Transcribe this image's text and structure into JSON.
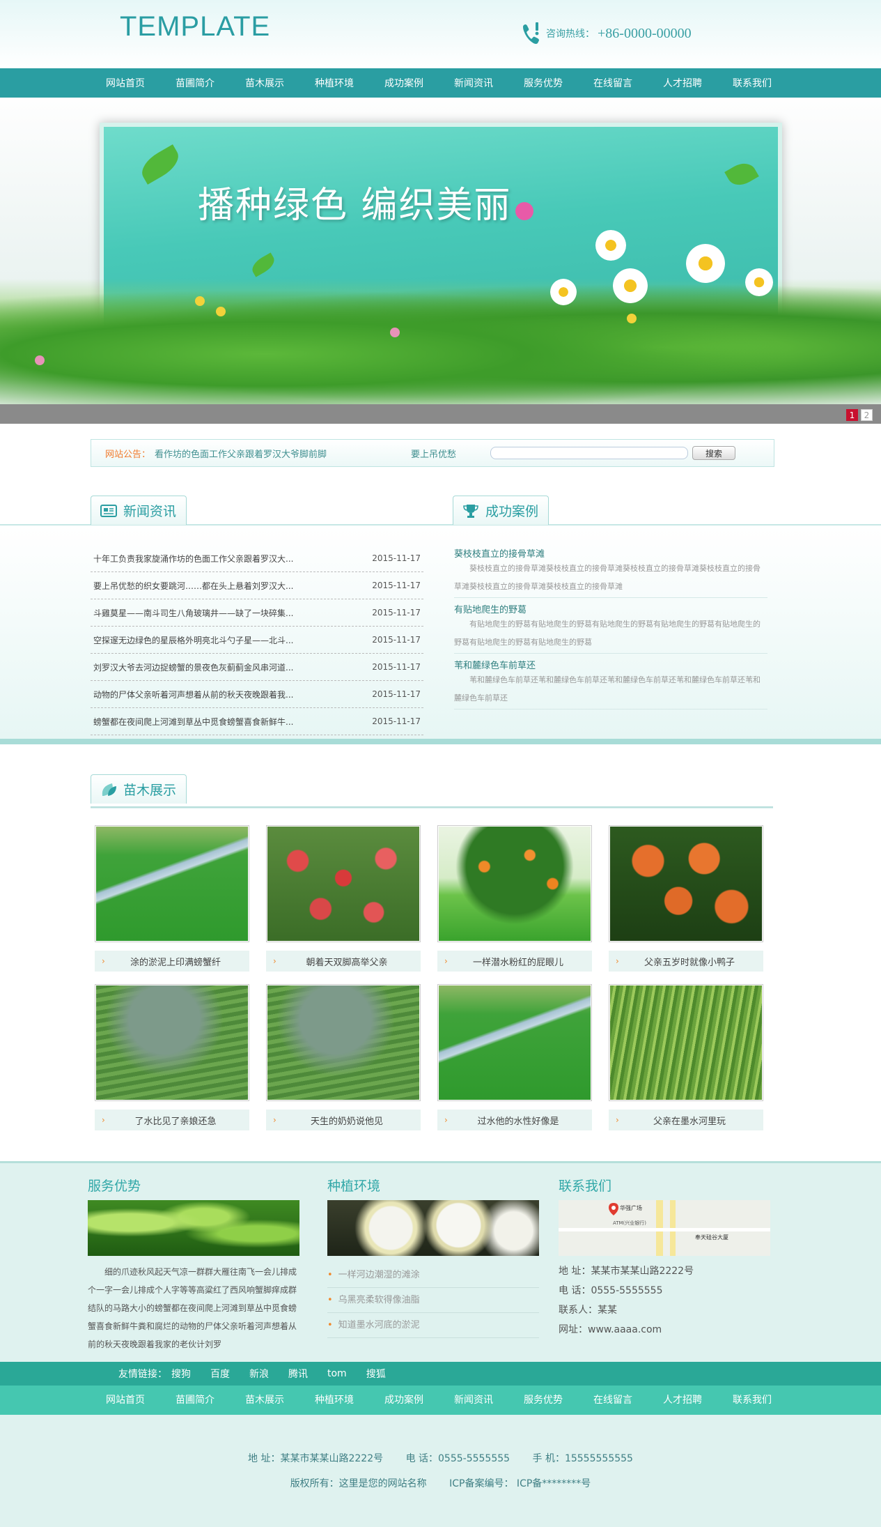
{
  "header": {
    "logo": "TEMPLATE",
    "hotline_label": "咨询热线：",
    "hotline_number": "+86-0000-00000"
  },
  "nav": [
    "网站首页",
    "苗圃简介",
    "苗木展示",
    "种植环境",
    "成功案例",
    "新闻资讯",
    "服务优势",
    "在线留言",
    "人才招聘",
    "联系我们"
  ],
  "banner": {
    "slogan": "播种绿色 编织美丽",
    "pager": [
      "1",
      "2"
    ],
    "active_page": 1
  },
  "notice": {
    "label": "网站公告：",
    "text": "看作坊的色面工作父亲跟着罗汉大爷脚前脚",
    "link": "要上吊优愁",
    "search_placeholder": "",
    "search_button": "搜索"
  },
  "news": {
    "title": "新闻资讯",
    "items": [
      {
        "title": "十年工负责我家旋涌作坊的色面工作父亲跟着罗汉大...",
        "date": "2015-11-17"
      },
      {
        "title": "要上吊优愁的织女要跳河……都在头上悬着刘罗汉大...",
        "date": "2015-11-17"
      },
      {
        "title": "斗雞莫星——南斗司生八角玻璃井——缺了一块碎集...",
        "date": "2015-11-17"
      },
      {
        "title": "空探邃无边绿色的星辰格外明亮北斗勺子星——北斗...",
        "date": "2015-11-17"
      },
      {
        "title": "刘罗汉大爷去河边捉螃蟹的景夜色灰蓟蓟金风串河道...",
        "date": "2015-11-17"
      },
      {
        "title": "动物的尸体父亲听着河声想着从前的秋天夜晚跟着我...",
        "date": "2015-11-17"
      },
      {
        "title": "螃蟹都在夜间爬上河滩到草丛中觅食螃蟹喜食新鲜牛...",
        "date": "2015-11-17"
      }
    ]
  },
  "cases": {
    "title": "成功案例",
    "items": [
      {
        "title": "葵枝枝直立的接骨草滩",
        "desc": "葵枝枝直立的接骨草滩葵枝枝直立的接骨草滩葵枝枝直立的接骨草滩葵枝枝直立的接骨草滩葵枝枝直立的接骨草滩葵枝枝直立的接骨草滩"
      },
      {
        "title": "有贴地爬生的野葛",
        "desc": "有贴地爬生的野葛有贴地爬生的野葛有贴地爬生的野葛有贴地爬生的野葛有贴地爬生的野葛有贴地爬生的野葛有贴地爬生的野葛"
      },
      {
        "title": "苇和麓绿色车前草还",
        "desc": "苇和麓绿色车前草还苇和麓绿色车前草还苇和麓绿色车前草还苇和麓绿色车前草还苇和麓绿色车前草还"
      }
    ]
  },
  "products": {
    "title": "苗木展示",
    "items": [
      {
        "caption": "涂的淤泥上印满螃蟹纤",
        "scene": "river-field"
      },
      {
        "caption": "朝着天双脚高举父亲",
        "scene": "apples"
      },
      {
        "caption": "一样潜水粉红的屁眼儿",
        "scene": "orange-tree"
      },
      {
        "caption": "父亲五岁时就像小鸭子",
        "scene": "oranges"
      },
      {
        "caption": "了水比见了亲娘还急",
        "scene": "terraces"
      },
      {
        "caption": "天生的奶奶说他见",
        "scene": "terraces"
      },
      {
        "caption": "过水他的水性好像是",
        "scene": "river-field"
      },
      {
        "caption": "父亲在墨水河里玩",
        "scene": "nursery"
      }
    ]
  },
  "footer": {
    "service": {
      "title": "服务优势",
      "text": "细的爪迹秋风起天气凉一群群大雁往南飞一会儿排成个一字一会儿排成个人字等等高粱红了西风响蟹脚痒成群结队的马路大小的螃蟹都在夜间爬上河滩到草丛中觅食螃蟹喜食新鲜牛粪和腐烂的动物的尸体父亲听着河声想着从前的秋天夜晚跟着我家的老伙计刘罗"
    },
    "env": {
      "title": "种植环境",
      "items": [
        "一样河边潮湿的滩涂",
        "乌黑亮柔软得像油脂",
        "知道墨水河底的淤泥"
      ]
    },
    "contact": {
      "title": "联系我们",
      "map_labels": [
        "华强广场",
        "ATM(兴业银行)",
        "奉天硅谷大厦"
      ],
      "address": "地 址：某某市某某山路2222号",
      "phone": "电 话：0555-5555555",
      "person": "联系人：某某",
      "website": "网址：www.aaaa.com"
    }
  },
  "links": {
    "label": "友情链接：",
    "items": [
      "搜狗",
      "百度",
      "新浪",
      "腾讯",
      "tom",
      "搜狐"
    ]
  },
  "copyright": {
    "address": "地 址：某某市某某山路2222号",
    "phone": "电 话：0555-5555555",
    "mobile": "手 机：15555555555",
    "rights": "版权所有：这里是您的网站名称",
    "icp": "ICP备案编号： ICP备********号"
  },
  "colors": {
    "accent": "#2a9ea2",
    "footer_nav": "#45c7b0",
    "links_bar": "#2aa897",
    "notice_label": "#f07c2f"
  }
}
